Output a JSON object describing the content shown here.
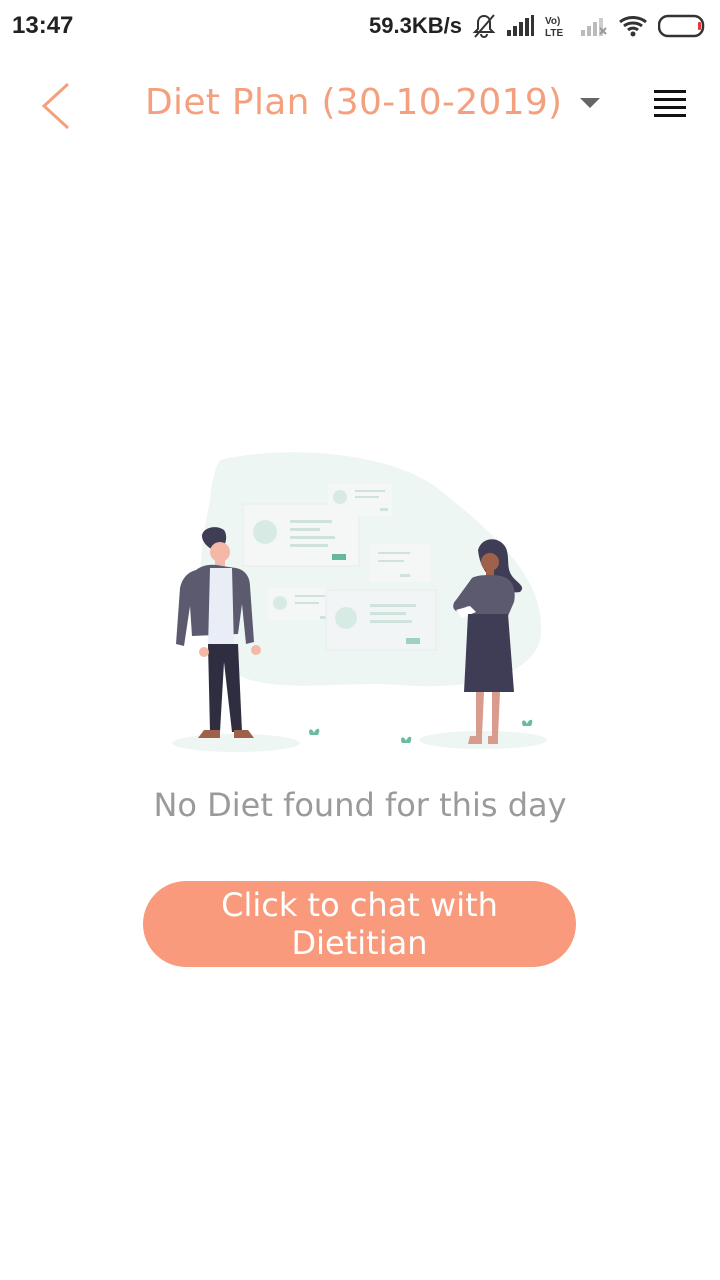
{
  "status_bar": {
    "time": "13:47",
    "network_speed": "59.3KB/s",
    "lte_label": "Vo) LTE",
    "icons": [
      "bell-off-icon",
      "signal-icon",
      "lte-icon",
      "signal-weak-icon",
      "wifi-icon",
      "battery-icon"
    ]
  },
  "header": {
    "title": "Diet Plan (30-10-2019)",
    "back_icon": "chevron-left-icon",
    "dropdown_icon": "caret-down-icon",
    "menu_icon": "list-icon"
  },
  "main": {
    "empty_message": "No Diet found for this day",
    "chat_button_label": "Click to chat with Dietitian"
  },
  "colors": {
    "accent": "#f4a07e",
    "button": "#f89a7b",
    "empty_text": "#9a9a9a"
  }
}
